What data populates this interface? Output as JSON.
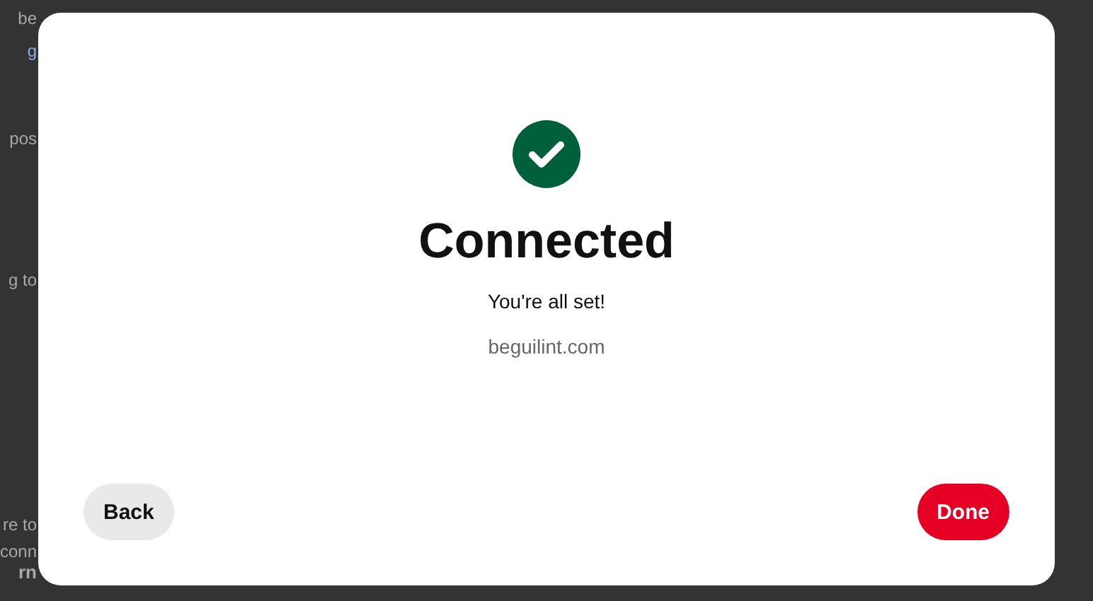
{
  "background_page": {
    "fragments": [
      {
        "text": "be",
        "kind": "plain"
      },
      {
        "text": "g",
        "kind": "link"
      },
      {
        "text": "pos",
        "kind": "plain"
      },
      {
        "text": "g to",
        "kind": "plain"
      },
      {
        "text": "re to",
        "kind": "plain"
      },
      {
        "text": "conn",
        "kind": "plain"
      },
      {
        "text": "rn",
        "kind": "bold"
      }
    ]
  },
  "dialog": {
    "title": "Connected",
    "message": "You're all set!",
    "site": "beguilint.com",
    "buttons": [
      {
        "label": "Back",
        "kind": "secondary"
      },
      {
        "label": "Done",
        "kind": "primary"
      }
    ]
  }
}
